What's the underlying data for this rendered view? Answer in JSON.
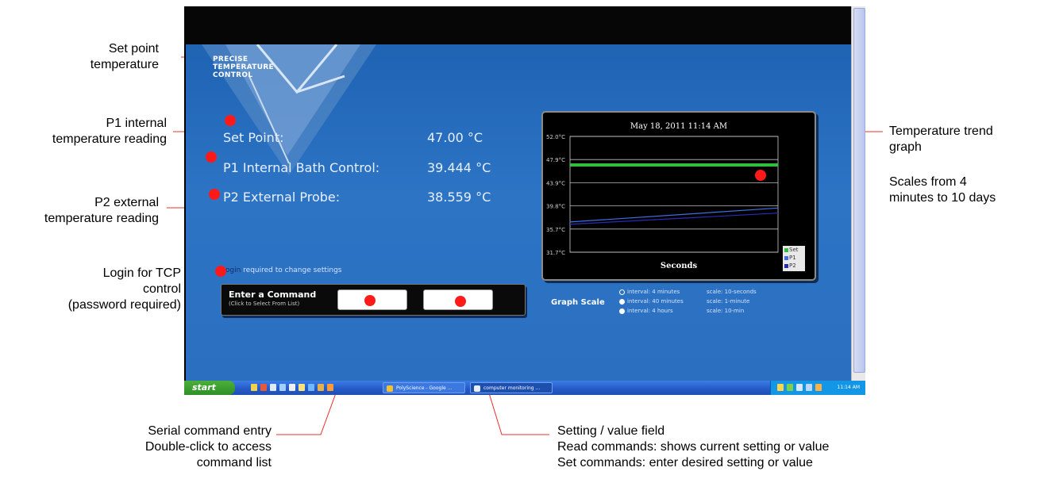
{
  "annotations": {
    "set_point": [
      "Set point",
      "temperature"
    ],
    "p1": [
      "P1 internal",
      "temperature reading"
    ],
    "p2": [
      "P2 external",
      "temperature reading"
    ],
    "login": [
      "Login for TCP",
      "control",
      "(password required)"
    ],
    "trend": [
      "Temperature trend",
      "graph"
    ],
    "scales": [
      "Scales from 4",
      "minutes to 10 days"
    ],
    "serial": [
      "Serial command entry",
      "Double-click to access",
      "command list"
    ],
    "setting": [
      "Setting / value field",
      "Read commands: shows current setting or value",
      "Set commands: enter desired setting or value"
    ]
  },
  "app": {
    "logo": [
      "PRECISE",
      "TEMPERATURE",
      "CONTROL"
    ],
    "readings": [
      {
        "label": "Set Point:",
        "value": "47.00 °C"
      },
      {
        "label": "P1 Internal Bath Control:",
        "value": "39.444 °C"
      },
      {
        "label": "P2 External Probe:",
        "value": "38.559 °C"
      }
    ],
    "login_link": "Login",
    "login_text": "required to change settings",
    "command_title": "Enter a Command",
    "command_sub": "(Click to Select From List)",
    "command_value": "",
    "setting_value": ""
  },
  "graph_scale": {
    "label": "Graph Scale",
    "options": [
      {
        "interval": "interval: 4 minutes",
        "scale": "scale: 10-seconds",
        "selected": true
      },
      {
        "interval": "interval: 40 minutes",
        "scale": "scale: 1-minute",
        "selected": false
      },
      {
        "interval": "interval: 4 hours",
        "scale": "scale: 10-min",
        "selected": false
      }
    ]
  },
  "taskbar": {
    "start": "start",
    "tasks": [
      "PolyScience - Google ...",
      "computer monitoring ..."
    ],
    "clock": "11:14 AM"
  },
  "colors": {
    "set": "#2fbf3f",
    "p1": "#3f6fe0",
    "p2": "#2a2ab8"
  },
  "chart_data": {
    "type": "line",
    "title": "May 18, 2011 11:14 AM",
    "xlabel": "Seconds",
    "ylabel": "",
    "yticks": [
      "52.0°C",
      "47.9°C",
      "43.9°C",
      "39.8°C",
      "35.7°C",
      "31.7°C"
    ],
    "ylim": [
      31.7,
      52.0
    ],
    "x": [
      0,
      1
    ],
    "series": [
      {
        "name": "Set",
        "values": [
          47.0,
          47.0
        ]
      },
      {
        "name": "P1",
        "values": [
          37.0,
          39.444
        ]
      },
      {
        "name": "P2",
        "values": [
          36.6,
          38.559
        ]
      }
    ],
    "legend_position": "bottom-right"
  }
}
